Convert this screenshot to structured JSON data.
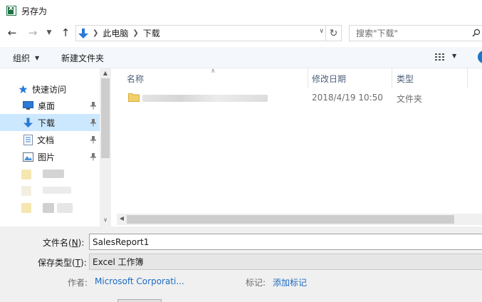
{
  "window": {
    "title": "另存为"
  },
  "nav": {
    "crumbs": [
      "此电脑",
      "下载"
    ],
    "search_placeholder": "搜索\"下载\""
  },
  "toolbar": {
    "organize_label": "组织",
    "new_folder_label": "新建文件夹"
  },
  "sidebar": {
    "quick_access_label": "快速访问",
    "items": [
      {
        "label": "桌面",
        "icon": "desktop-icon",
        "pinned": true
      },
      {
        "label": "下载",
        "icon": "download-icon",
        "pinned": true,
        "selected": true
      },
      {
        "label": "文档",
        "icon": "document-icon",
        "pinned": true
      },
      {
        "label": "图片",
        "icon": "picture-icon",
        "pinned": true
      }
    ]
  },
  "filelist": {
    "columns": [
      "名称",
      "修改日期",
      "类型"
    ],
    "rows": [
      {
        "name": "",
        "modified": "2018/4/19 10:50",
        "type": "文件夹"
      }
    ]
  },
  "form": {
    "filename_label": "文件名(",
    "filename_mnemonic": "N",
    "filename_label_end": "):",
    "filename_value": "SalesReport1",
    "filetype_label": "保存类型(",
    "filetype_mnemonic": "T",
    "filetype_label_end": "):",
    "filetype_value": "Excel 工作簿",
    "author_label": "作者:",
    "author_value": "Microsoft Corporati...",
    "tags_label": "标记:",
    "tags_value": "添加标记"
  },
  "colors": {
    "selection": "#cce8ff",
    "link": "#1c6bc2",
    "accent": "#2a7ad6",
    "folder": "#f2cf6b"
  }
}
